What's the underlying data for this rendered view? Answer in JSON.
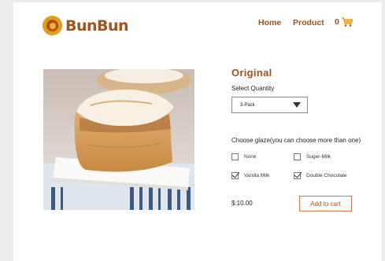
{
  "header": {
    "brand": "BunBun",
    "nav": {
      "home": "Home",
      "product": "Product"
    },
    "cart_count": "0"
  },
  "product": {
    "title": "Original",
    "quantity_label": "Select Quantity",
    "quantity_selected": "3-Pack",
    "glaze_label": "Choose glaze(you can choose more than one)",
    "glaze_options": [
      {
        "label": "None",
        "checked": false
      },
      {
        "label": "Suger-Milk",
        "checked": false
      },
      {
        "label": "Vanilla Milk",
        "checked": true
      },
      {
        "label": "Double Chocolate",
        "checked": true
      }
    ],
    "price": "$:10.00",
    "add_to_cart": "Add to cart"
  },
  "colors": {
    "brand": "#a0531b",
    "background": "#ececec",
    "panel": "#ffffff"
  },
  "icons": {
    "logo": "cinnamon-roll-logo",
    "cart": "shopping-cart-icon",
    "dropdown": "triangle-down-icon"
  }
}
